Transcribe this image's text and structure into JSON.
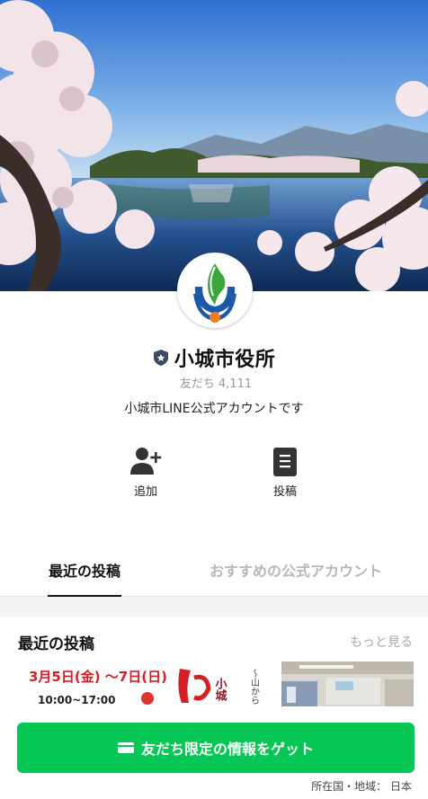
{
  "account": {
    "name": "小城市役所",
    "friends_label": "友だち",
    "friends_count": "4,111",
    "description": "小城市LINE公式アカウントです"
  },
  "actions": {
    "add_label": "追加",
    "posts_label": "投稿"
  },
  "tabs": {
    "recent_posts": "最近の投稿",
    "recommended": "おすすめの公式アカウント"
  },
  "section": {
    "title": "最近の投稿",
    "more": "もっと見る"
  },
  "thumbnail": {
    "date_text": "3月5日(金) 〜7日(日)",
    "time_text": "10:00~17:00",
    "vertical_text": "小城",
    "small_text": "〜山から"
  },
  "cta": {
    "label": "友だち限定の情報をゲット"
  },
  "footer": {
    "country": "所在国・地域： 日本"
  },
  "colors": {
    "cta_green": "#06c755",
    "logo_blue": "#1c5aa8",
    "logo_green": "#3aa73a",
    "logo_orange": "#ef7d1a"
  },
  "icons": {
    "badge": "shield-badge-icon",
    "add": "add-friend-icon",
    "posts": "posts-document-icon",
    "wallet": "wallet-icon"
  }
}
